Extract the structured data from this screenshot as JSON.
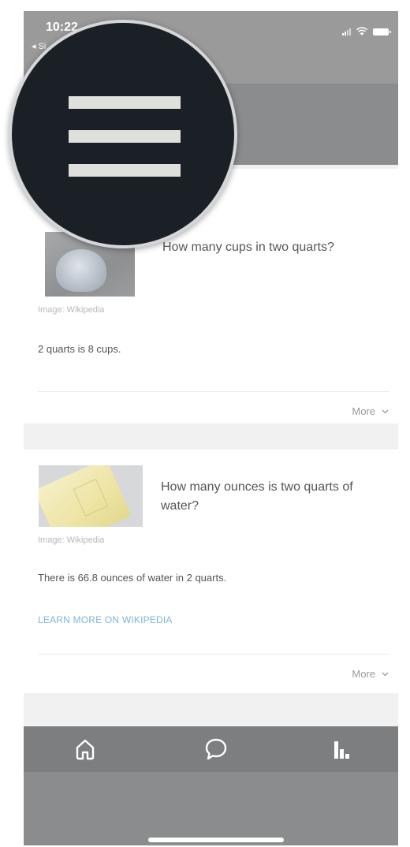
{
  "status_bar": {
    "time": "10:22",
    "back_label": "◂ Si"
  },
  "icons": {
    "menu": "menu-icon",
    "home": "home-icon",
    "chat": "chat-bubble-icon",
    "stats": "bar-chart-icon",
    "chevron": "chevron-down-icon",
    "signal": "signal-icon",
    "wifi": "wifi-icon",
    "battery": "battery-icon"
  },
  "results": [
    {
      "question": "How many cups in two quarts?",
      "image_source": "Image: Wikipedia",
      "answer": "2 quarts is 8 cups.",
      "more_label": "More"
    },
    {
      "question": "How many ounces is two quarts of water?",
      "image_source": "Image: Wikipedia",
      "answer": "There is 66.8 ounces of water in 2 quarts.",
      "link_label": "LEARN MORE ON WIKIPEDIA",
      "more_label": "More"
    }
  ],
  "colors": {
    "header_bg": "#8b8c8d",
    "nav_bg": "#7d7e80",
    "magnifier_bg": "#1b1f26",
    "link": "#7fb6d6"
  }
}
